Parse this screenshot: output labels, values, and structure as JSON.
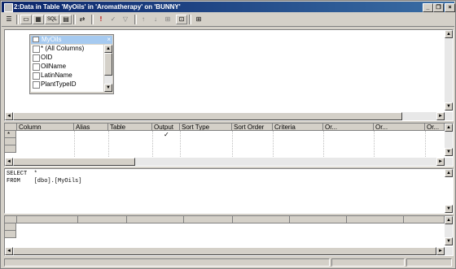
{
  "window": {
    "title": "2:Data in Table 'MyOils' in 'Aromatherapy' on 'BUNNY'",
    "minimize_icon": "minimize-icon",
    "restore_icon": "restore-icon",
    "close_icon": "close-icon"
  },
  "toolbar": {
    "buttons": [
      {
        "name": "properties-icon",
        "glyph": "☰"
      },
      {
        "name": "diagram-pane-icon",
        "glyph": "▭"
      },
      {
        "name": "grid-pane-icon",
        "glyph": "▦"
      },
      {
        "name": "sql-pane-icon",
        "glyph": "SQL"
      },
      {
        "name": "results-pane-icon",
        "glyph": "▤"
      },
      {
        "name": "change-type-icon",
        "glyph": "⇄"
      },
      {
        "name": "run-icon",
        "glyph": "!"
      },
      {
        "name": "verify-sql-icon",
        "glyph": "✓"
      },
      {
        "name": "remove-filter-icon",
        "glyph": "▽"
      },
      {
        "name": "sort-ascending-icon",
        "glyph": "↑"
      },
      {
        "name": "sort-descending-icon",
        "glyph": "↓"
      },
      {
        "name": "group-by-icon",
        "glyph": "⊞"
      },
      {
        "name": "add-table-icon",
        "glyph": "⊡"
      }
    ]
  },
  "diagram": {
    "table": {
      "name": "MyOils",
      "columns": [
        {
          "label": "* (All Columns)"
        },
        {
          "label": "OID"
        },
        {
          "label": "OilName"
        },
        {
          "label": "LatinName"
        },
        {
          "label": "PlantTypeID"
        }
      ]
    }
  },
  "grid": {
    "headers": [
      "Column",
      "Alias",
      "Table",
      "Output",
      "Sort Type",
      "Sort Order",
      "Criteria",
      "Or...",
      "Or...",
      "Or..."
    ],
    "row_marker": "*",
    "output_check": "✓"
  },
  "sql": {
    "line1": "SELECT  *",
    "line2": "FROM    [dbo].[MyOils]"
  },
  "scroll": {
    "up": "▲",
    "down": "▼",
    "left": "◄",
    "right": "►"
  }
}
